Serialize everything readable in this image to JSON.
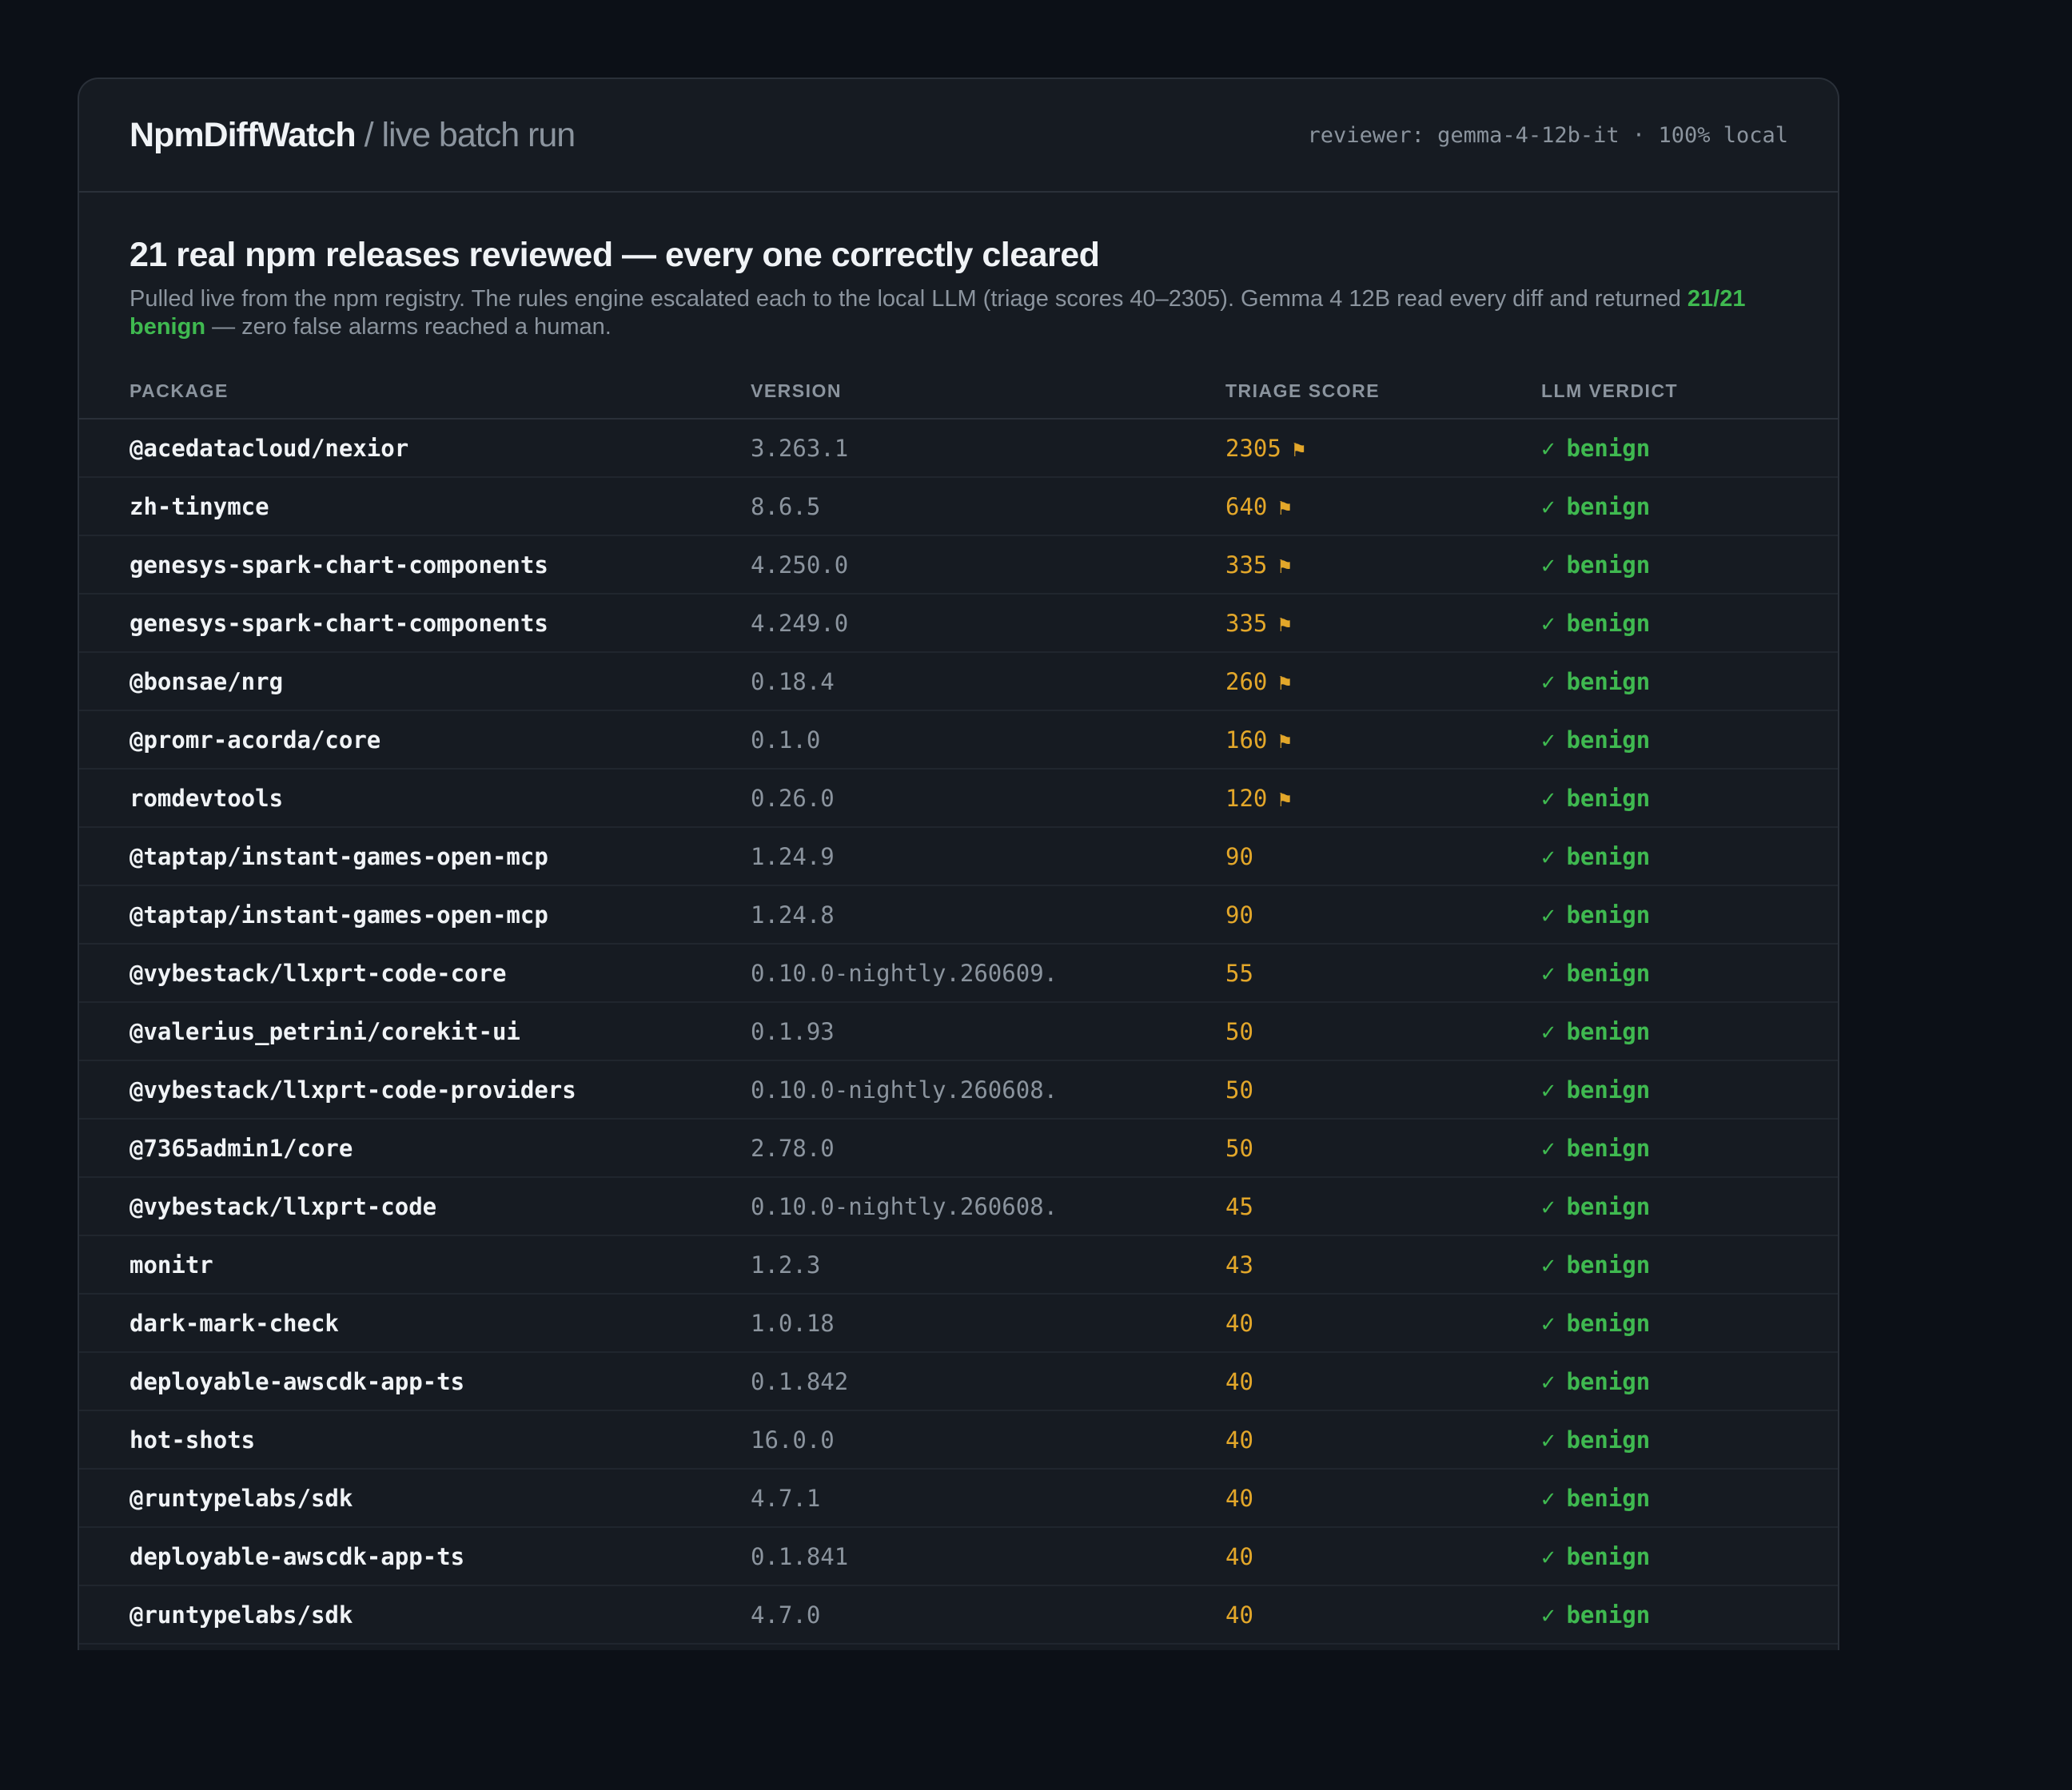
{
  "header": {
    "brand_name": "NpmDiffWatch",
    "brand_sub": "/ live batch run",
    "reviewer": "reviewer: gemma-4-12b-it · 100% local"
  },
  "summary": {
    "title": "21 real npm releases reviewed — every one correctly cleared",
    "text_before": "Pulled live from the npm registry. The rules engine escalated each to the local LLM (triage scores 40–2305). Gemma 4 12B read every diff and returned ",
    "highlight": "21/21 benign",
    "text_after": " — zero false alarms reached a human."
  },
  "table": {
    "columns": [
      "PACKAGE",
      "VERSION",
      "TRIAGE SCORE",
      "LLM VERDICT"
    ],
    "flag_glyph": "⚑",
    "check_glyph": "✓",
    "rows": [
      {
        "package": "@acedatacloud/nexior",
        "version": "3.263.1",
        "score": "2305",
        "flagged": true,
        "verdict": "benign"
      },
      {
        "package": "zh-tinymce",
        "version": "8.6.5",
        "score": "640",
        "flagged": true,
        "verdict": "benign"
      },
      {
        "package": "genesys-spark-chart-components",
        "version": "4.250.0",
        "score": "335",
        "flagged": true,
        "verdict": "benign"
      },
      {
        "package": "genesys-spark-chart-components",
        "version": "4.249.0",
        "score": "335",
        "flagged": true,
        "verdict": "benign"
      },
      {
        "package": "@bonsae/nrg",
        "version": "0.18.4",
        "score": "260",
        "flagged": true,
        "verdict": "benign"
      },
      {
        "package": "@promr-acorda/core",
        "version": "0.1.0",
        "score": "160",
        "flagged": true,
        "verdict": "benign"
      },
      {
        "package": "romdevtools",
        "version": "0.26.0",
        "score": "120",
        "flagged": true,
        "verdict": "benign"
      },
      {
        "package": "@taptap/instant-games-open-mcp",
        "version": "1.24.9",
        "score": "90",
        "flagged": false,
        "verdict": "benign"
      },
      {
        "package": "@taptap/instant-games-open-mcp",
        "version": "1.24.8",
        "score": "90",
        "flagged": false,
        "verdict": "benign"
      },
      {
        "package": "@vybestack/llxprt-code-core",
        "version": "0.10.0-nightly.260609.",
        "score": "55",
        "flagged": false,
        "verdict": "benign"
      },
      {
        "package": "@valerius_petrini/corekit-ui",
        "version": "0.1.93",
        "score": "50",
        "flagged": false,
        "verdict": "benign"
      },
      {
        "package": "@vybestack/llxprt-code-providers",
        "version": "0.10.0-nightly.260608.",
        "score": "50",
        "flagged": false,
        "verdict": "benign"
      },
      {
        "package": "@7365admin1/core",
        "version": "2.78.0",
        "score": "50",
        "flagged": false,
        "verdict": "benign"
      },
      {
        "package": "@vybestack/llxprt-code",
        "version": "0.10.0-nightly.260608.",
        "score": "45",
        "flagged": false,
        "verdict": "benign"
      },
      {
        "package": "monitr",
        "version": "1.2.3",
        "score": "43",
        "flagged": false,
        "verdict": "benign"
      },
      {
        "package": "dark-mark-check",
        "version": "1.0.18",
        "score": "40",
        "flagged": false,
        "verdict": "benign"
      },
      {
        "package": "deployable-awscdk-app-ts",
        "version": "0.1.842",
        "score": "40",
        "flagged": false,
        "verdict": "benign"
      },
      {
        "package": "hot-shots",
        "version": "16.0.0",
        "score": "40",
        "flagged": false,
        "verdict": "benign"
      },
      {
        "package": "@runtypelabs/sdk",
        "version": "4.7.1",
        "score": "40",
        "flagged": false,
        "verdict": "benign"
      },
      {
        "package": "deployable-awscdk-app-ts",
        "version": "0.1.841",
        "score": "40",
        "flagged": false,
        "verdict": "benign"
      },
      {
        "package": "@runtypelabs/sdk",
        "version": "4.7.0",
        "score": "40",
        "flagged": false,
        "verdict": "benign"
      }
    ]
  }
}
